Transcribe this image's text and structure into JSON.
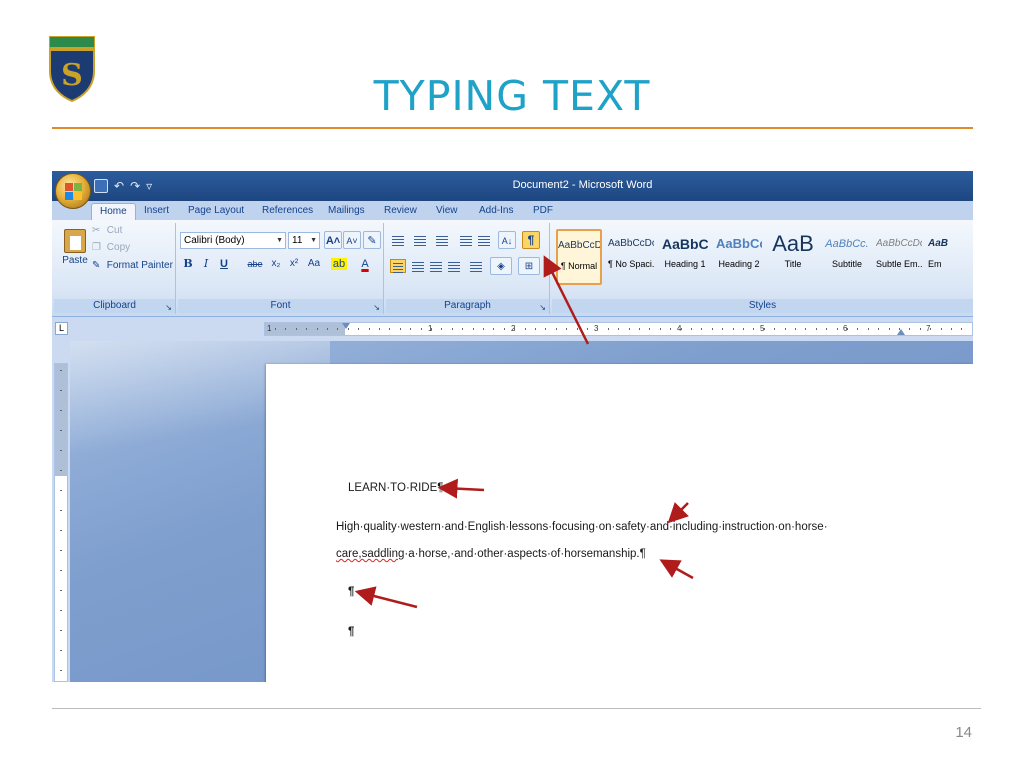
{
  "slide": {
    "title": "TYPING TEXT",
    "page_number": "14",
    "logo_letter": "S"
  },
  "word": {
    "window_title": "Document2 - Microsoft Word",
    "tabs": [
      "Home",
      "Insert",
      "Page Layout",
      "References",
      "Mailings",
      "Review",
      "View",
      "Add-Ins",
      "PDF"
    ],
    "active_tab": "Home",
    "clipboard": {
      "paste_label": "Paste",
      "cut_label": "Cut",
      "copy_label": "Copy",
      "format_painter_label": "Format Painter",
      "group_label": "Clipboard"
    },
    "font": {
      "font_name": "Calibri (Body)",
      "font_size": "11",
      "group_label": "Font",
      "bold": "B",
      "italic": "I",
      "underline": "U",
      "strike": "abe",
      "subscript": "x₂",
      "superscript": "x²",
      "change_case": "Aa",
      "grow": "A˄",
      "shrink": "A˅"
    },
    "paragraph": {
      "group_label": "Paragraph",
      "show_hide": "¶"
    },
    "styles": {
      "group_label": "Styles",
      "items": [
        {
          "sample": "AaBbCcDc",
          "name": "¶ Normal"
        },
        {
          "sample": "AaBbCcDc",
          "name": "¶ No Spaci..."
        },
        {
          "sample": "AaBbC",
          "name": "Heading 1"
        },
        {
          "sample": "AaBbCc",
          "name": "Heading 2"
        },
        {
          "sample": "AaB",
          "name": "Title"
        },
        {
          "sample": "AaBbCc.",
          "name": "Subtitle"
        },
        {
          "sample": "AaBbCcDc",
          "name": "Subtle Em..."
        },
        {
          "sample": "AaB",
          "name": "Em"
        }
      ]
    },
    "ruler_numbers": [
      "1",
      "1",
      "2",
      "3",
      "4",
      "5",
      "6",
      "7"
    ],
    "document": {
      "line1": "LEARN·TO·RIDE¶",
      "line2": "High·quality·western·and·English·lessons·focusing·on·safety·and·including·instruction·on·horse·",
      "line3_err": "care,saddling",
      "line3_rest": "·a·horse,·and·other·aspects·of·horsemanship.¶",
      "line4": "¶",
      "line5": "¶"
    },
    "colors": {
      "title": "#1fa2c8",
      "accent_rule": "#e08a2c",
      "annotation_arrow": "#b01c1c"
    }
  }
}
